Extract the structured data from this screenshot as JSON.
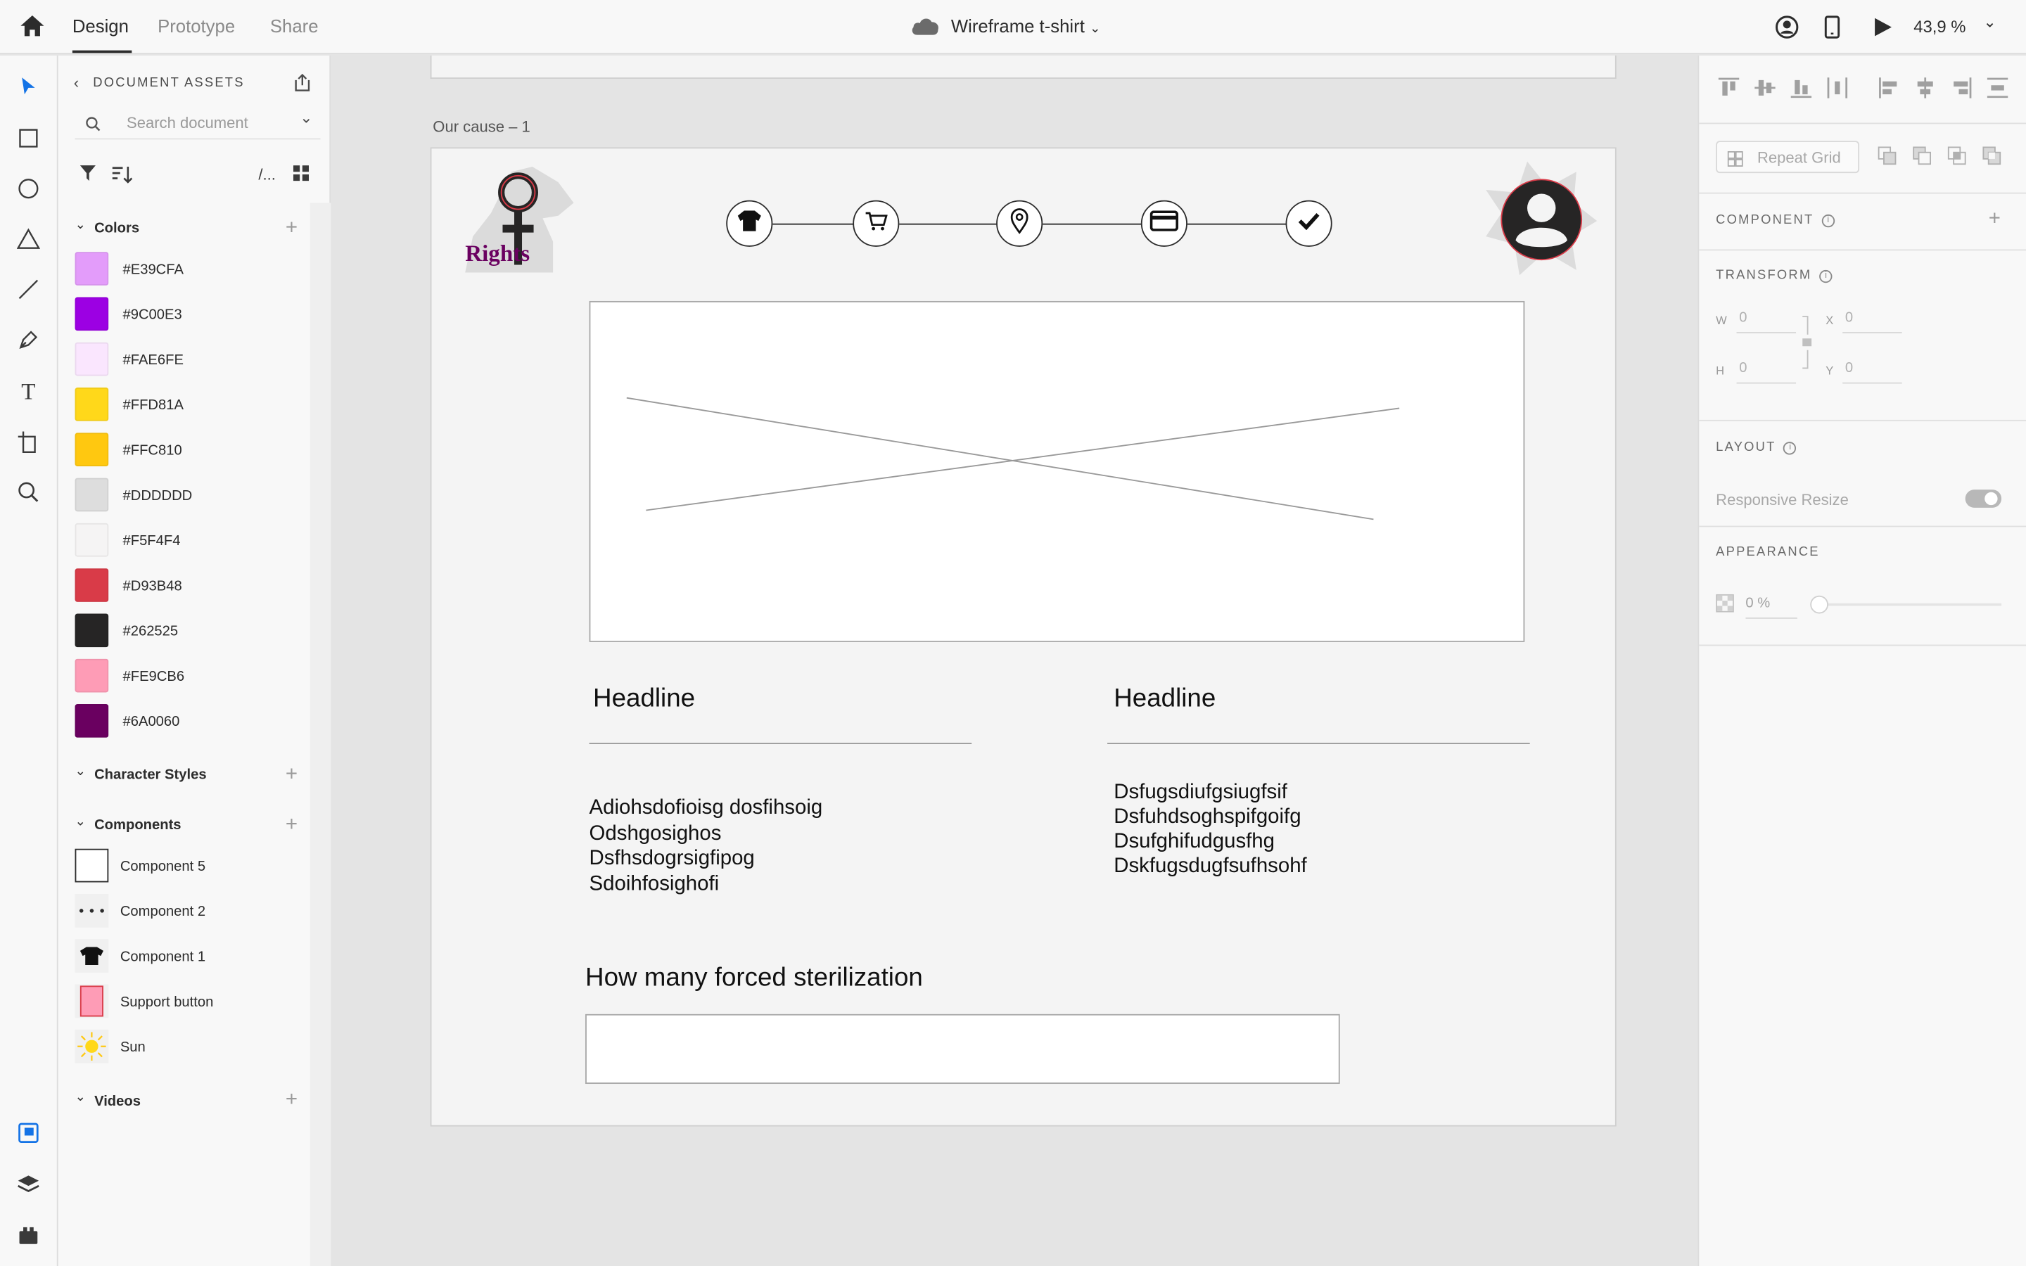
{
  "topbar": {
    "tabs": [
      "Design",
      "Prototype",
      "Share"
    ],
    "document_title": "Wireframe t-shirt",
    "zoom": "43,9 %"
  },
  "assets": {
    "title": "DOCUMENT ASSETS",
    "search_placeholder": "Search document",
    "filter_tag": "/...",
    "sections": {
      "colors": "Colors",
      "character_styles": "Character Styles",
      "components": "Components",
      "videos": "Videos"
    },
    "colors": [
      "#E39CFA",
      "#9C00E3",
      "#FAE6FE",
      "#FFD81A",
      "#FFC810",
      "#DDDDDD",
      "#F5F4F4",
      "#D93B48",
      "#262525",
      "#FE9CB6",
      "#6A0060"
    ],
    "components": [
      "Component 5",
      "Component 2",
      "Component 1",
      "Support button",
      "Sun"
    ]
  },
  "canvas": {
    "artboard_label": "Our cause – 1",
    "logo_text": "Rights",
    "steps": [
      "tshirt-icon",
      "cart-icon",
      "location-icon",
      "card-icon",
      "check-icon"
    ],
    "left_headline": "Headline",
    "right_headline": "Headline",
    "left_lines": [
      "Adiohsdofioisg dosfihsoig",
      "Odshgosighos",
      "Dsfhsdogrsigfipog",
      "Sdoihfosighofi"
    ],
    "right_lines": [
      "Dsfugsdiufgsiugfsif",
      "Dsfuhdsoghspifgoifg",
      "Dsufghifudgusfhg",
      "Dskfugsdugfsufhsohf"
    ],
    "question": "How many forced sterilization"
  },
  "inspector": {
    "repeat_grid": "Repeat Grid",
    "component": "COMPONENT",
    "transform": "TRANSFORM",
    "w_label": "W",
    "w_value": "0",
    "h_label": "H",
    "h_value": "0",
    "x_label": "X",
    "x_value": "0",
    "y_label": "Y",
    "y_value": "0",
    "layout": "LAYOUT",
    "responsive_resize": "Responsive Resize",
    "appearance": "APPEARANCE",
    "opacity": "0 %"
  }
}
